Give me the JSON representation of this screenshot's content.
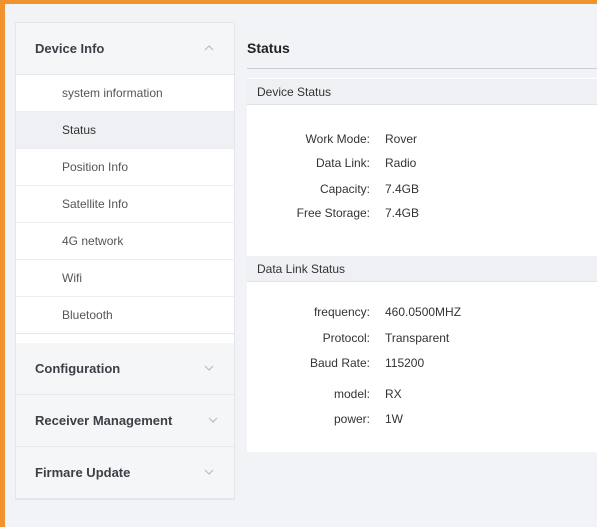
{
  "sidebar": {
    "device_info": {
      "label": "Device Info",
      "items": [
        {
          "label": "system information"
        },
        {
          "label": "Status"
        },
        {
          "label": "Position Info"
        },
        {
          "label": "Satellite Info"
        },
        {
          "label": "4G network"
        },
        {
          "label": "Wifi"
        },
        {
          "label": "Bluetooth"
        }
      ]
    },
    "configuration": {
      "label": "Configuration"
    },
    "receiver_management": {
      "label": "Receiver Management"
    },
    "firmware_update": {
      "label": "Firmare Update"
    }
  },
  "main": {
    "title": "Status",
    "device_status": {
      "header": "Device Status",
      "rows": [
        {
          "label": "Work Mode:",
          "value": "Rover"
        },
        {
          "label": "Data Link:",
          "value": "Radio"
        },
        {
          "label": "Capacity:",
          "value": "7.4GB"
        },
        {
          "label": "Free Storage:",
          "value": "7.4GB"
        }
      ]
    },
    "data_link_status": {
      "header": "Data Link Status",
      "rows": [
        {
          "label": "frequency:",
          "value": "460.0500MHZ"
        },
        {
          "label": "Protocol:",
          "value": "Transparent"
        },
        {
          "label": "Baud Rate:",
          "value": "115200"
        },
        {
          "label": "model:",
          "value": "RX"
        },
        {
          "label": "power:",
          "value": "1W"
        }
      ]
    }
  },
  "colors": {
    "frame_accent": "#f0922d",
    "active_item": "#eef0f4"
  }
}
